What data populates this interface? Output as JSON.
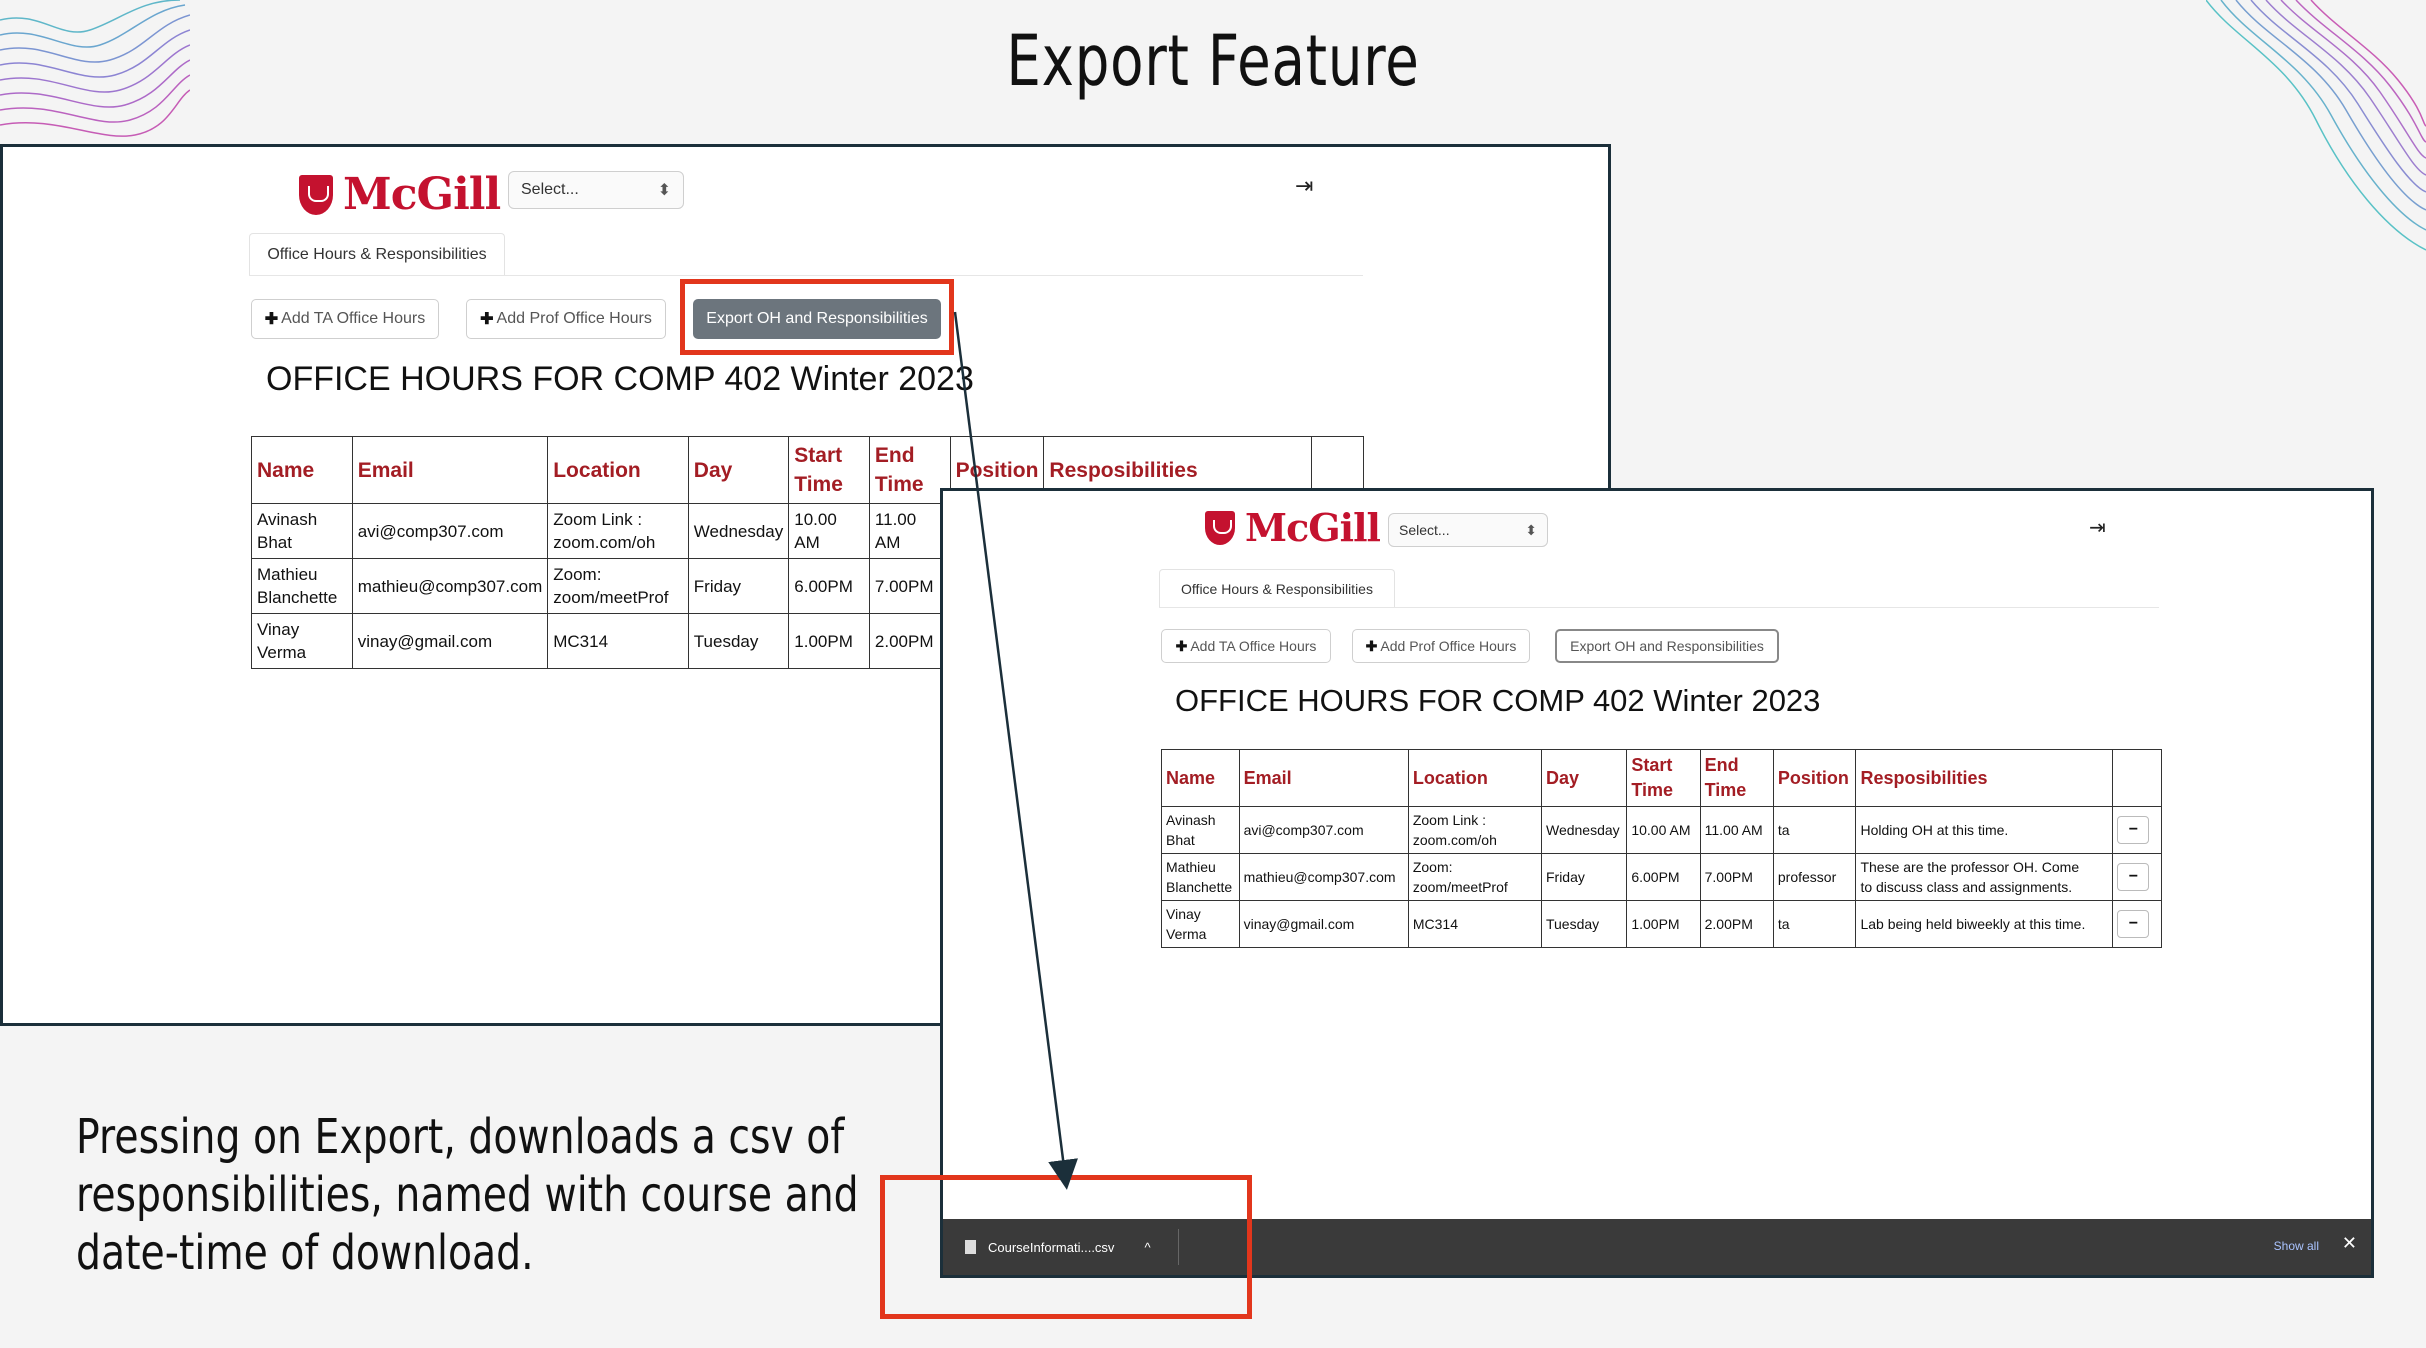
{
  "slide": {
    "title": "Export Feature",
    "caption_lines": [
      "Pressing on Export, downloads a csv of",
      "responsibilities, named with course and",
      "date-time of download."
    ]
  },
  "app": {
    "logo_text": "McGill",
    "select_placeholder": "Select...",
    "select_arrow": "⬍",
    "logout_icon": "⇥",
    "tab_label": "Office Hours & Responsibilities",
    "plus": "✚",
    "add_ta_label": "Add TA Office Hours",
    "add_prof_label": "Add Prof Office Hours",
    "export_label": "Export OH and Responsibilities",
    "heading": "OFFICE HOURS FOR COMP 402 Winter 2023"
  },
  "table1": {
    "headers": [
      "Name",
      "Email",
      "Location",
      "Day",
      "Start\nTime",
      "End\nTime",
      "Position",
      "Resposibilities"
    ],
    "rows": [
      [
        "Avinash Bhat",
        "avi@comp307.com",
        "Zoom Link :\nzoom.com/oh",
        "Wednesday",
        "10.00 AM",
        "11.00 AM"
      ],
      [
        "Mathieu\nBlanchette",
        "mathieu@comp307.com",
        "Zoom:\nzoom/meetProf",
        "Friday",
        "6.00PM",
        "7.00PM"
      ],
      [
        "Vinay Verma",
        "vinay@gmail.com",
        "MC314",
        "Tuesday",
        "1.00PM",
        "2.00PM"
      ]
    ]
  },
  "table2": {
    "headers": [
      "Name",
      "Email",
      "Location",
      "Day",
      "Start\nTime",
      "End\nTime",
      "Position",
      "Resposibilities"
    ],
    "rows": [
      [
        "Avinash Bhat",
        "avi@comp307.com",
        "Zoom Link :\nzoom.com/oh",
        "Wednesday",
        "10.00 AM",
        "11.00 AM",
        "ta",
        "Holding OH at this time."
      ],
      [
        "Mathieu\nBlanchette",
        "mathieu@comp307.com",
        "Zoom:\nzoom/meetProf",
        "Friday",
        "6.00PM",
        "7.00PM",
        "professor",
        "These are the professor OH. Come\nto discuss class and assignments."
      ],
      [
        "Vinay Verma",
        "vinay@gmail.com",
        "MC314",
        "Tuesday",
        "1.00PM",
        "2.00PM",
        "ta",
        "Lab being held biweekly at this time."
      ]
    ],
    "delete_symbol": "−"
  },
  "download_bar": {
    "file_name": "CourseInformati....csv",
    "chevron": "^",
    "show_all": "Show all",
    "close": "✕"
  },
  "colors": {
    "accent_red": "#c4122f",
    "header_red": "#a31d24",
    "highlight_box": "#e2361c",
    "arrow": "#1b2f3a"
  }
}
